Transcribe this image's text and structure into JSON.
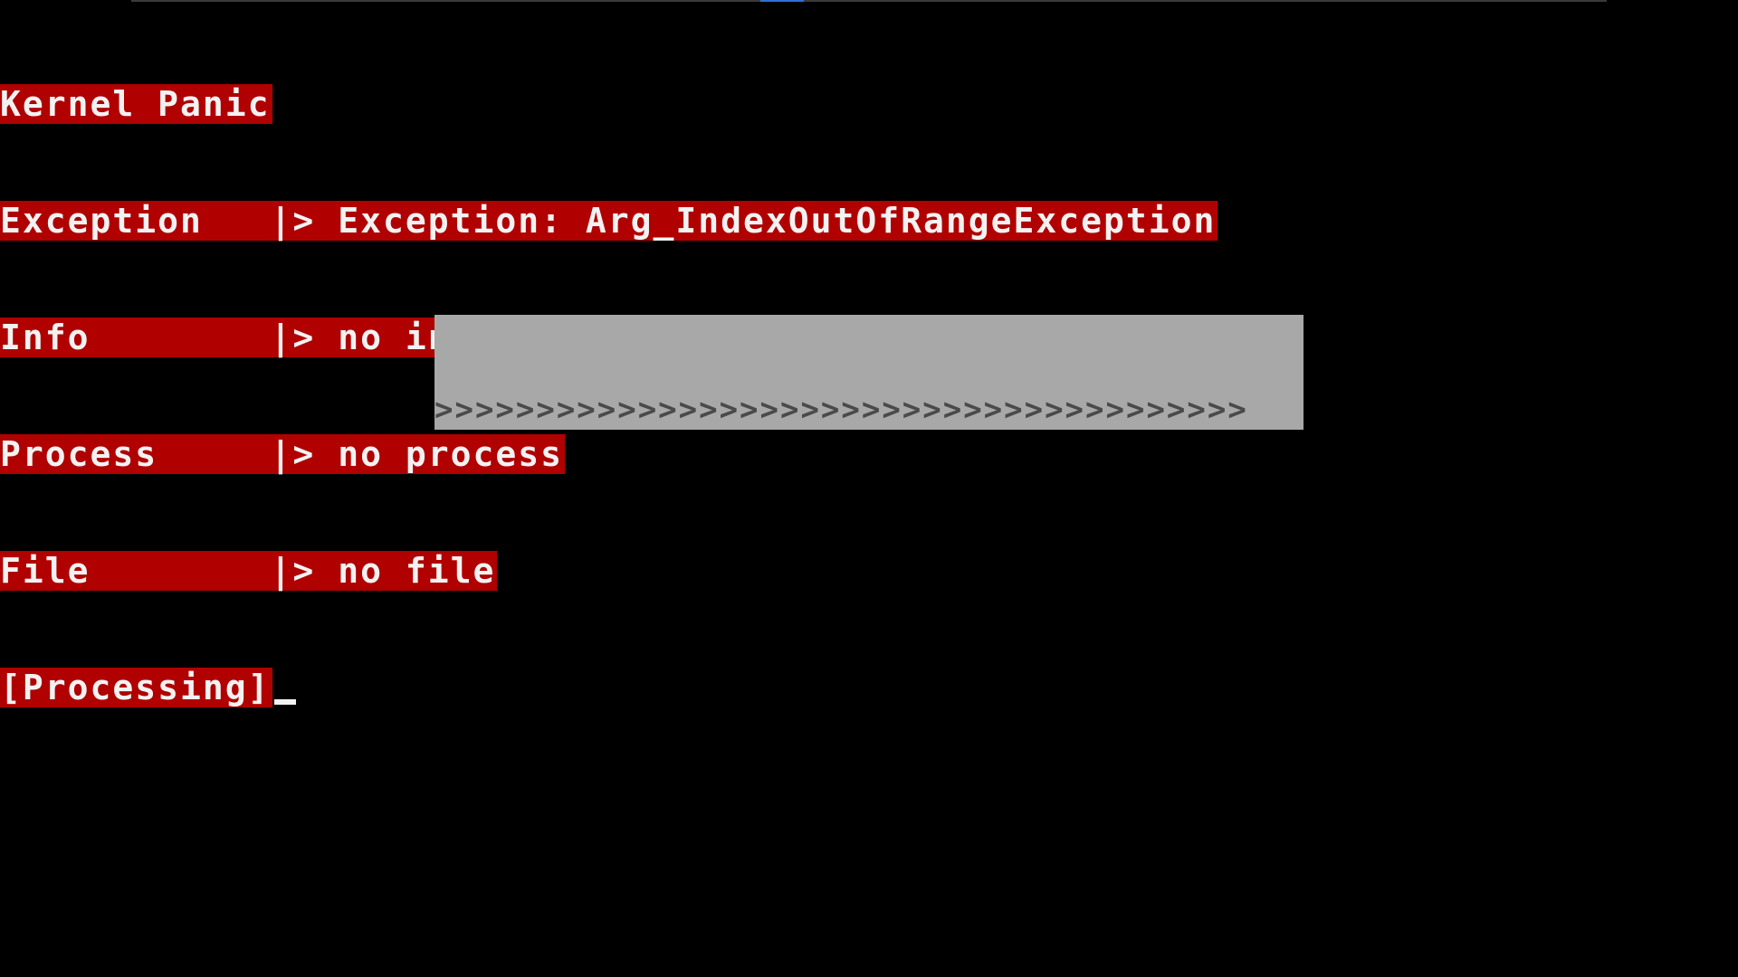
{
  "colors": {
    "background": "#000000",
    "highlight": "#b00000",
    "text": "#f2f2f2",
    "progress_bg": "#a8a8a8",
    "progress_text": "#4a4a4a"
  },
  "panic": {
    "title": "Kernel Panic",
    "rows": [
      {
        "label": "Exception  ",
        "sep": " |> ",
        "value": "Exception: Arg_IndexOutOfRangeException"
      },
      {
        "label": "Info       ",
        "sep": " |> ",
        "value": "no info"
      },
      {
        "label": "Process    ",
        "sep": " |> ",
        "value": "no process"
      },
      {
        "label": "File       ",
        "sep": " |> ",
        "value": "no file"
      }
    ],
    "status": "[Processing]"
  },
  "progress": {
    "row1": ">>>>>>>>>>>>>>>>>>>>>>>>>>>>>>>>>>>>>>>>",
    "row2_left": "<<<<<<<<<<",
    "row2_right": ">>>>>>>>>>",
    "row3": "<<<<<<<<<<<<<<<<<<<<<<<<<<<<<<<<<<<<<<<<"
  }
}
